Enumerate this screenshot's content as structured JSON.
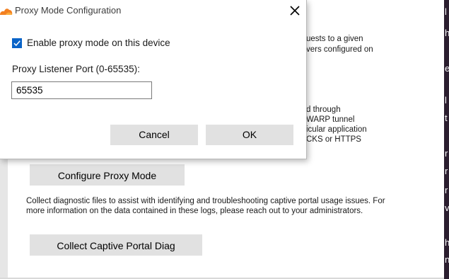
{
  "dialog": {
    "title": "Proxy Mode Configuration",
    "checkbox_label": "Enable proxy mode on this device",
    "checkbox_checked": true,
    "port_label": "Proxy Listener Port (0-65535):",
    "port_value": "65535",
    "cancel_label": "Cancel",
    "ok_label": "OK"
  },
  "background": {
    "fragments": [
      "uests to a given",
      "vers configured on",
      "d through",
      "WARP tunnel",
      "icular application",
      "CKS or HTTPS"
    ],
    "configure_proxy_label": "Configure Proxy Mode",
    "diag_description": "Collect diagnostic files to assist with identifying and troubleshooting captive portal usage issues. For more information on the data contained in these logs, please reach out to your administrators.",
    "collect_diag_label": "Collect Captive Portal Diag"
  },
  "colors": {
    "accent": "#0a64c8",
    "button": "#e1e1e1",
    "brand_orange": "#f38020"
  }
}
